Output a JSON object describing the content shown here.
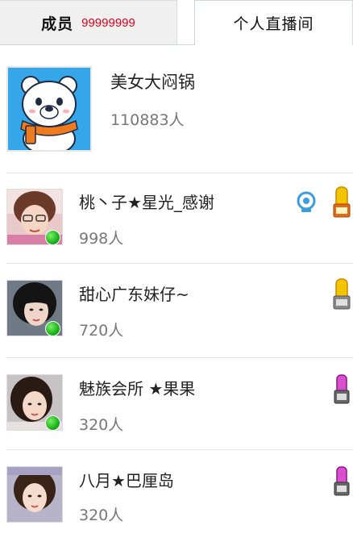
{
  "tabs": {
    "members_label": "成员",
    "members_count": "99999999",
    "live_label": "个人直播间"
  },
  "room": {
    "name": "美女大闷锅",
    "count": "110883人",
    "avatar_icon": "polar-bear-mascot-icon"
  },
  "users": [
    {
      "name": "桃丶子★星光_感谢",
      "count": "998人",
      "badges": [
        "webcam-icon",
        "gold-level-badge-icon"
      ]
    },
    {
      "name": "甜心广东妹仔~",
      "count": "720人",
      "badges": [
        "gold-level-badge-icon"
      ]
    },
    {
      "name": "魅族会所 ★果果",
      "count": "320人",
      "badges": [
        "purple-level-badge-icon"
      ]
    },
    {
      "name": "八月★巴厘岛",
      "count": "320人",
      "badges": [
        "purple-level-badge-icon"
      ]
    }
  ],
  "colors": {
    "accent_red": "#e0001b",
    "room_avatar_bg": "#35a7e8",
    "online_green": "#19b319"
  }
}
